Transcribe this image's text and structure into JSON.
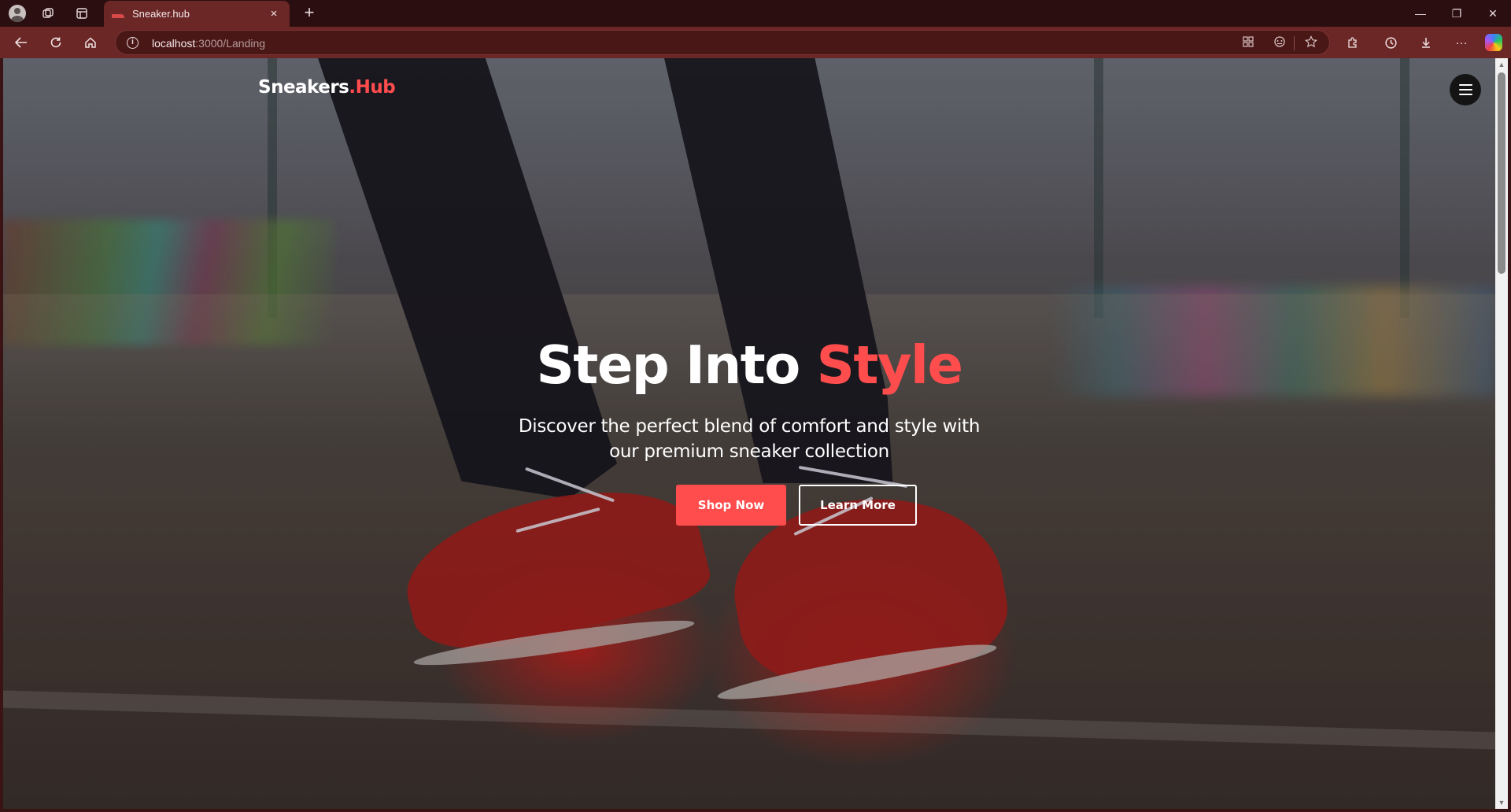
{
  "browser": {
    "tab_title": "Sneaker.hub",
    "tab_close": "×",
    "new_tab": "+",
    "url_host": "localhost",
    "url_path": ":3000/Landing",
    "window_controls": {
      "minimize": "—",
      "restore": "❐",
      "close": "✕"
    },
    "toolbar_more": "···"
  },
  "page": {
    "brand": {
      "name": "Sneakers",
      "accent": ".Hub"
    },
    "hero": {
      "title_main": "Step Into ",
      "title_accent": "Style",
      "subtitle": "Discover the perfect blend of comfort and style with our premium sneaker collection",
      "primary_button": "Shop Now",
      "secondary_button": "Learn More"
    }
  },
  "colors": {
    "accent": "#ff4d4d",
    "browser_frame": "#6b2626",
    "tab_strip": "#2b0f10"
  },
  "icons": [
    "profile-avatar-icon",
    "workspaces-icon",
    "tab-actions-icon",
    "back-icon",
    "refresh-icon",
    "home-icon",
    "info-icon",
    "app-available-icon",
    "tracking-prevention-icon",
    "favorite-star-icon",
    "extensions-icon",
    "history-icon",
    "downloads-icon",
    "more-icon",
    "copilot-icon",
    "hamburger-menu-icon"
  ]
}
